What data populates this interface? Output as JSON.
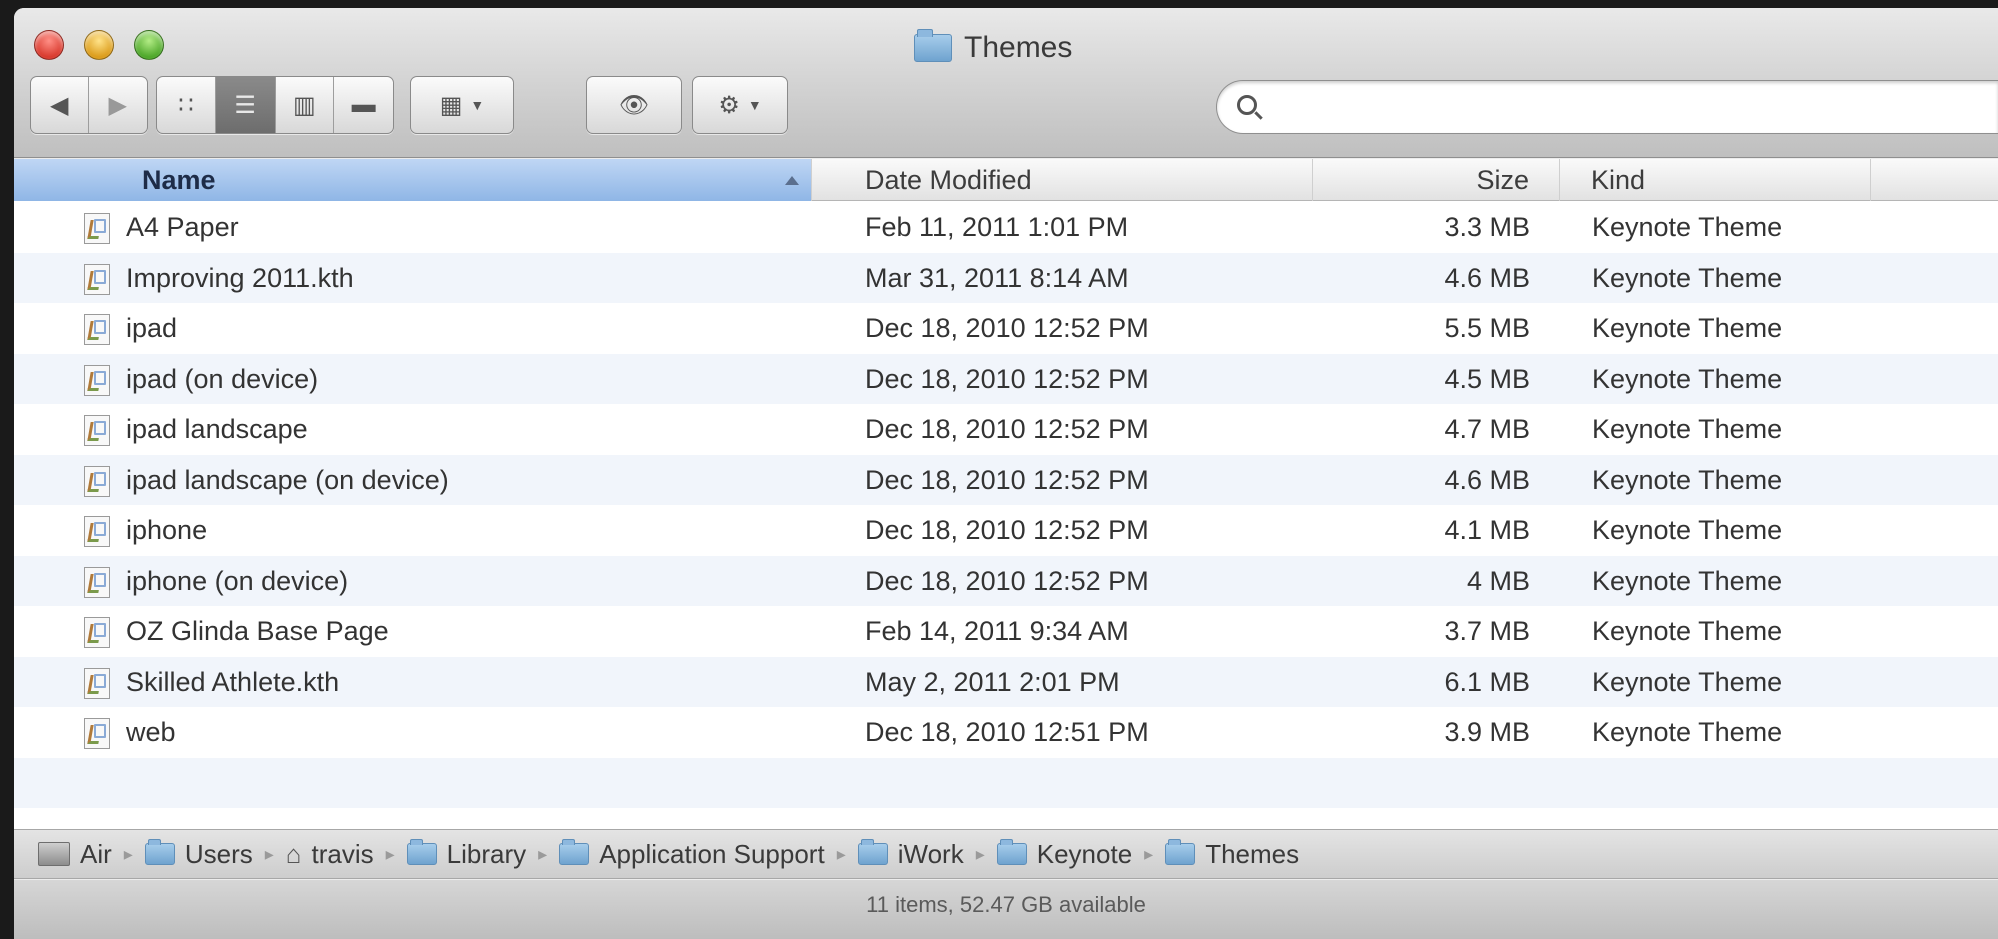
{
  "window": {
    "title": "Themes"
  },
  "toolbar": {
    "back_icon": "back-arrow-icon",
    "forward_icon": "forward-arrow-icon",
    "view_modes": [
      "icon-view",
      "list-view",
      "column-view",
      "cover-flow-view"
    ],
    "active_view": "list-view",
    "arrange_icon": "arrange-grid-icon",
    "quicklook_icon": "eye-icon",
    "action_icon": "gear-icon",
    "search": {
      "placeholder": "",
      "value": ""
    }
  },
  "columns": {
    "name": "Name",
    "date": "Date Modified",
    "size": "Size",
    "kind": "Kind"
  },
  "files": [
    {
      "name": "A4 Paper",
      "date": "Feb 11, 2011 1:01 PM",
      "size": "3.3 MB",
      "kind": "Keynote Theme"
    },
    {
      "name": "Improving 2011.kth",
      "date": "Mar 31, 2011 8:14 AM",
      "size": "4.6 MB",
      "kind": "Keynote Theme"
    },
    {
      "name": "ipad",
      "date": "Dec 18, 2010 12:52 PM",
      "size": "5.5 MB",
      "kind": "Keynote Theme"
    },
    {
      "name": "ipad (on device)",
      "date": "Dec 18, 2010 12:52 PM",
      "size": "4.5 MB",
      "kind": "Keynote Theme"
    },
    {
      "name": "ipad landscape",
      "date": "Dec 18, 2010 12:52 PM",
      "size": "4.7 MB",
      "kind": "Keynote Theme"
    },
    {
      "name": "ipad landscape (on device)",
      "date": "Dec 18, 2010 12:52 PM",
      "size": "4.6 MB",
      "kind": "Keynote Theme"
    },
    {
      "name": "iphone",
      "date": "Dec 18, 2010 12:52 PM",
      "size": "4.1 MB",
      "kind": "Keynote Theme"
    },
    {
      "name": "iphone (on device)",
      "date": "Dec 18, 2010 12:52 PM",
      "size": "4 MB",
      "kind": "Keynote Theme"
    },
    {
      "name": "OZ Glinda Base Page",
      "date": "Feb 14, 2011 9:34 AM",
      "size": "3.7 MB",
      "kind": "Keynote Theme"
    },
    {
      "name": "Skilled Athlete.kth",
      "date": "May 2, 2011 2:01 PM",
      "size": "6.1 MB",
      "kind": "Keynote Theme"
    },
    {
      "name": "web",
      "date": "Dec 18, 2010 12:51 PM",
      "size": "3.9 MB",
      "kind": "Keynote Theme"
    }
  ],
  "path": [
    "Air",
    "Users",
    "travis",
    "Library",
    "Application Support",
    "iWork",
    "Keynote",
    "Themes"
  ],
  "status": "11 items, 52.47 GB available",
  "colors": {
    "selection_header": "#9dbfe9",
    "row_alt": "#f1f5fb",
    "folder": "#7fb0da"
  }
}
